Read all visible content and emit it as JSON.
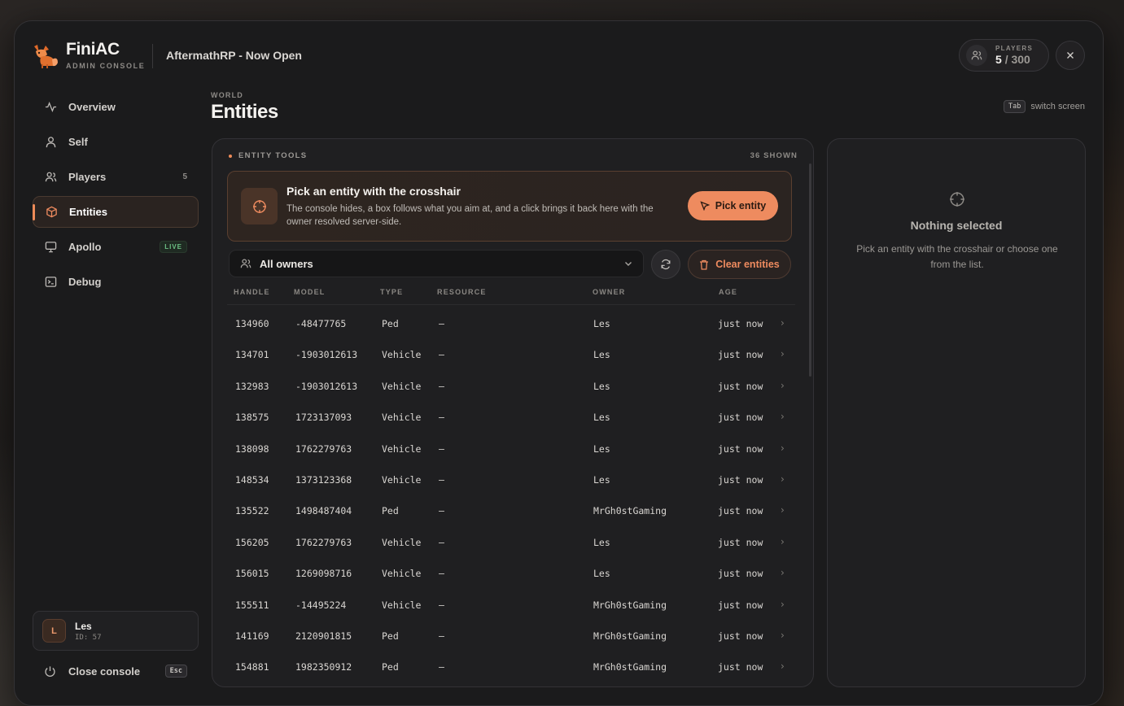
{
  "brand": {
    "name": "FiniAC",
    "subtitle": "ADMIN CONSOLE"
  },
  "server_name": "AftermathRP - Now Open",
  "players": {
    "label": "PLAYERS",
    "current": "5",
    "max": "/ 300"
  },
  "nav": [
    {
      "label": "Overview",
      "icon": "activity-icon"
    },
    {
      "label": "Self",
      "icon": "user-icon"
    },
    {
      "label": "Players",
      "icon": "users-icon",
      "count": "5"
    },
    {
      "label": "Entities",
      "icon": "cube-icon",
      "active": true
    },
    {
      "label": "Apollo",
      "icon": "monitor-icon",
      "badge": "LIVE"
    },
    {
      "label": "Debug",
      "icon": "terminal-icon"
    }
  ],
  "user": {
    "initial": "L",
    "name": "Les",
    "id": "ID: 57"
  },
  "close_console": {
    "label": "Close console",
    "key": "Esc"
  },
  "page": {
    "crumb": "WORLD",
    "title": "Entities"
  },
  "hint": {
    "key": "Tab",
    "text": "switch screen"
  },
  "entity_tools": {
    "heading": "ENTITY TOOLS",
    "shown": "36 SHOWN",
    "picker": {
      "title": "Pick an entity with the crosshair",
      "description": "The console hides, a box follows what you aim at, and a click brings it back here with the owner resolved server-side.",
      "button": "Pick entity"
    },
    "owner_filter": "All owners",
    "clear_button": "Clear entities"
  },
  "table": {
    "columns": [
      "HANDLE",
      "MODEL",
      "TYPE",
      "RESOURCE",
      "OWNER",
      "AGE"
    ],
    "rows": [
      {
        "handle": "134960",
        "model": "-48477765",
        "type": "Ped",
        "resource": "—",
        "owner": "Les",
        "age": "just now"
      },
      {
        "handle": "134701",
        "model": "-1903012613",
        "type": "Vehicle",
        "resource": "—",
        "owner": "Les",
        "age": "just now"
      },
      {
        "handle": "132983",
        "model": "-1903012613",
        "type": "Vehicle",
        "resource": "—",
        "owner": "Les",
        "age": "just now"
      },
      {
        "handle": "138575",
        "model": "1723137093",
        "type": "Vehicle",
        "resource": "—",
        "owner": "Les",
        "age": "just now"
      },
      {
        "handle": "138098",
        "model": "1762279763",
        "type": "Vehicle",
        "resource": "—",
        "owner": "Les",
        "age": "just now"
      },
      {
        "handle": "148534",
        "model": "1373123368",
        "type": "Vehicle",
        "resource": "—",
        "owner": "Les",
        "age": "just now"
      },
      {
        "handle": "135522",
        "model": "1498487404",
        "type": "Ped",
        "resource": "—",
        "owner": "MrGh0stGaming",
        "age": "just now"
      },
      {
        "handle": "156205",
        "model": "1762279763",
        "type": "Vehicle",
        "resource": "—",
        "owner": "Les",
        "age": "just now"
      },
      {
        "handle": "156015",
        "model": "1269098716",
        "type": "Vehicle",
        "resource": "—",
        "owner": "Les",
        "age": "just now"
      },
      {
        "handle": "155511",
        "model": "-14495224",
        "type": "Vehicle",
        "resource": "—",
        "owner": "MrGh0stGaming",
        "age": "just now"
      },
      {
        "handle": "141169",
        "model": "2120901815",
        "type": "Ped",
        "resource": "—",
        "owner": "MrGh0stGaming",
        "age": "just now"
      },
      {
        "handle": "154881",
        "model": "1982350912",
        "type": "Ped",
        "resource": "—",
        "owner": "MrGh0stGaming",
        "age": "just now"
      }
    ]
  },
  "detail": {
    "title": "Nothing selected",
    "description": "Pick an entity with the crosshair or choose one from the list."
  },
  "colors": {
    "accent": "#ee8b5f",
    "live": "#6cc084",
    "background": "#1b1b1c"
  }
}
